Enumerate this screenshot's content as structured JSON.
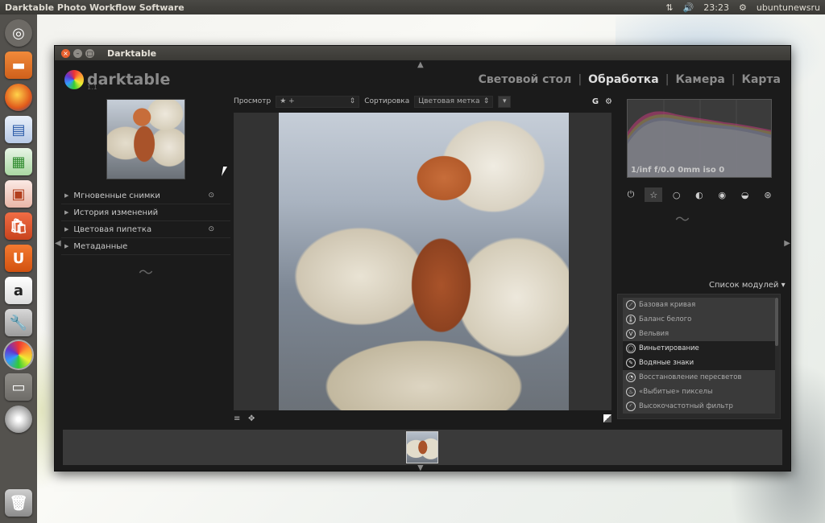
{
  "top_panel": {
    "app_title": "Darktable Photo Workflow Software",
    "time": "23:23",
    "user": "ubuntunewsru",
    "network_icon": "⇅",
    "volume_icon": "🔊",
    "gear_icon": "⚙"
  },
  "launcher": {
    "items": [
      {
        "name": "ubuntu-dash",
        "glyph": "◎"
      },
      {
        "name": "files",
        "glyph": "▬"
      },
      {
        "name": "firefox",
        "glyph": ""
      },
      {
        "name": "writer",
        "glyph": "▤"
      },
      {
        "name": "calc",
        "glyph": "▦"
      },
      {
        "name": "impress",
        "glyph": "▣"
      },
      {
        "name": "software-center",
        "glyph": "🛍"
      },
      {
        "name": "ubuntu-one",
        "glyph": "U"
      },
      {
        "name": "amazon",
        "glyph": "a"
      },
      {
        "name": "system-settings",
        "glyph": "🔧"
      },
      {
        "name": "darktable",
        "glyph": ""
      },
      {
        "name": "workspace-switcher",
        "glyph": "▭"
      },
      {
        "name": "disc",
        "glyph": ""
      },
      {
        "name": "trash",
        "glyph": "🗑"
      }
    ]
  },
  "window": {
    "title": "Darktable",
    "logo_text": "darktable",
    "version": "1.1",
    "views": [
      "Световой стол",
      "Обработка",
      "Камера",
      "Карта"
    ],
    "view_sep": "|"
  },
  "left_panel": {
    "sections": [
      {
        "label": "Мгновенные снимки",
        "icon": "⊙"
      },
      {
        "label": "История изменений",
        "icon": ""
      },
      {
        "label": "Цветовая пипетка",
        "icon": "⊙"
      },
      {
        "label": "Метаданные",
        "icon": ""
      }
    ],
    "squiggle": "〜"
  },
  "toolbar": {
    "view_label": "Просмотр",
    "view_value": "★ +",
    "sort_label": "Сортировка",
    "sort_value": "Цветовая метка",
    "sort_arrow": "▾",
    "dd_arrow": "⇕",
    "grouping_icon": "G",
    "gear_icon": "⚙"
  },
  "bottom_tools": {
    "menu_icon": "≡",
    "overlay_icon": "✥"
  },
  "histogram": {
    "exif": "1/inf f/0.0 0mm iso 0"
  },
  "module_groups": [
    "⏻",
    "☆",
    "○",
    "◐",
    "◉",
    "◒",
    "⊛"
  ],
  "module_list": {
    "label": "Список модулей ▾",
    "items": [
      {
        "label": "Базовая кривая",
        "on": false,
        "glyph": "⟋"
      },
      {
        "label": "Баланс белого",
        "on": false,
        "glyph": "🌡"
      },
      {
        "label": "Вельвия",
        "on": false,
        "glyph": "V"
      },
      {
        "label": "Виньетирование",
        "on": true,
        "glyph": "◯"
      },
      {
        "label": "Водяные знаки",
        "on": true,
        "glyph": "✎"
      },
      {
        "label": "Восстановление пересветов",
        "on": false,
        "glyph": "◔"
      },
      {
        "label": "«Выбитые» пикселы",
        "on": false,
        "glyph": "♨"
      },
      {
        "label": "Высокочастотный фильтр",
        "on": false,
        "glyph": "◜"
      }
    ]
  },
  "arrows": {
    "up": "▲",
    "down": "▼",
    "left": "◀",
    "right": "▶"
  }
}
